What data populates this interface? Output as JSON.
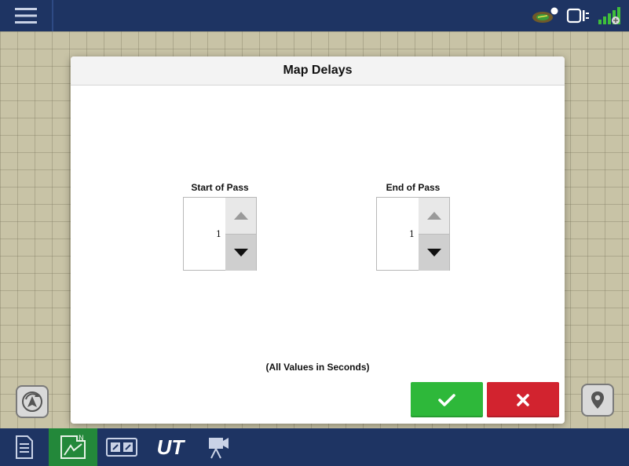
{
  "topbar": {
    "menu_icon": "hamburger-menu-icon",
    "status_icons": [
      "guidance-signal-icon",
      "display-link-icon",
      "gps-satellite-icon"
    ]
  },
  "dialog": {
    "title": "Map Delays",
    "fields": [
      {
        "label": "Start of Pass",
        "value": "1"
      },
      {
        "label": "End of Pass",
        "value": "1"
      }
    ],
    "units_note": "(All Values in Seconds)",
    "ok_icon": "checkmark-icon",
    "cancel_icon": "x-icon"
  },
  "side_buttons": {
    "left": "compass-navigate-icon",
    "right": "map-pin-icon"
  },
  "bottom_tabs": [
    {
      "icon": "document-icon",
      "active": false
    },
    {
      "icon": "field-map-icon",
      "active": true
    },
    {
      "icon": "split-screen-icon",
      "active": false
    },
    {
      "icon": "universal-terminal-icon",
      "label": "UT",
      "active": false
    },
    {
      "icon": "camera-icon",
      "active": false
    }
  ],
  "colors": {
    "header_bg": "#1e3463",
    "active_tab": "#23883a",
    "ok_button": "#2eb83a",
    "cancel_button": "#d2232f",
    "map_bg": "#c8c3a6"
  }
}
